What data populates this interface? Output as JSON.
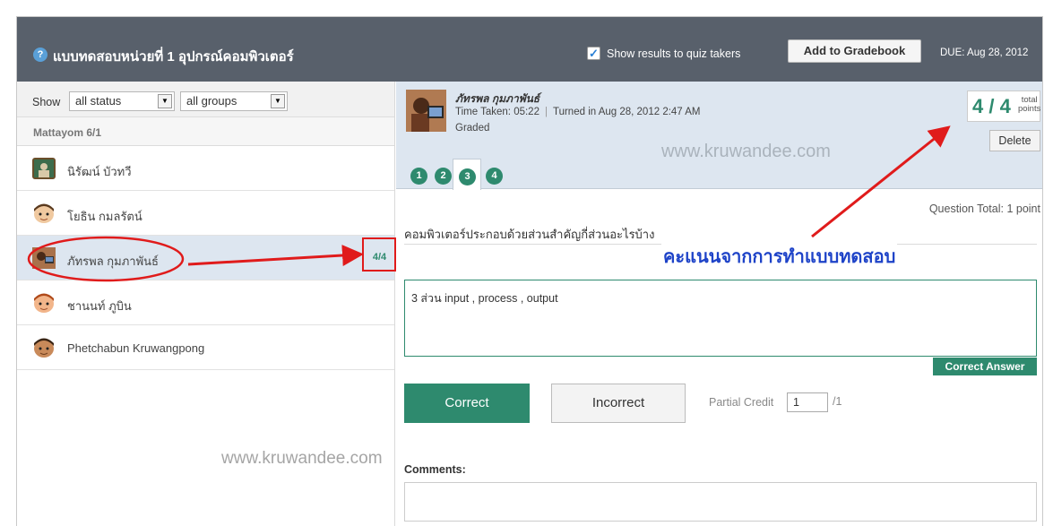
{
  "header": {
    "help_icon": "question-circle-icon",
    "title": "แบบทดสอบหน่วยที่ 1 อุปกรณ์คอมพิวเตอร์",
    "show_results_label": "Show results to quiz takers",
    "show_results_checked": true,
    "add_gradebook_label": "Add to Gradebook",
    "due_label": "DUE: Aug 28, 2012"
  },
  "filters": {
    "show_label": "Show",
    "status_value": "all status",
    "groups_value": "all groups"
  },
  "class_name": "Mattayom 6/1",
  "students": [
    {
      "name": "นิรัฒน์ บัวทวี",
      "selected": false,
      "score": ""
    },
    {
      "name": "โยธิน กมลรัตน์",
      "selected": false,
      "score": ""
    },
    {
      "name": "ภัทรพล กุมภาพันธ์",
      "selected": true,
      "score": "4/4"
    },
    {
      "name": "ชานนท์ ภูบิน",
      "selected": false,
      "score": ""
    },
    {
      "name": "Phetchabun Kruwangpong",
      "selected": false,
      "score": ""
    }
  ],
  "watermark": "www.kruwandee.com",
  "detail": {
    "student_name": "ภัทรพล กุมภาพันธ์",
    "time_taken": "Time Taken: 05:22",
    "turned_in": "Turned in Aug 28, 2012 2:47 AM",
    "status": "Graded",
    "points_value": "4 / 4",
    "points_label_1": "total",
    "points_label_2": "points",
    "delete_label": "Delete",
    "tabs": [
      "1",
      "2",
      "3",
      "4"
    ],
    "active_tab": "3"
  },
  "question": {
    "total": "Question Total: 1 point",
    "text": "คอมพิวเตอร์ประกอบด้วยส่วนสำคัญกี่ส่วนอะไรบ้าง",
    "answer": "3 ส่วน input , process , output",
    "correct_answer_label": "Correct Answer"
  },
  "grading": {
    "correct_label": "Correct",
    "incorrect_label": "Incorrect",
    "partial_label": "Partial Credit",
    "partial_value": "1",
    "partial_max": "/1",
    "comments_label": "Comments:"
  },
  "annotation": {
    "caption": "คะแนนจากการทำแบบทดสอบ",
    "color": "#e01b1b"
  }
}
